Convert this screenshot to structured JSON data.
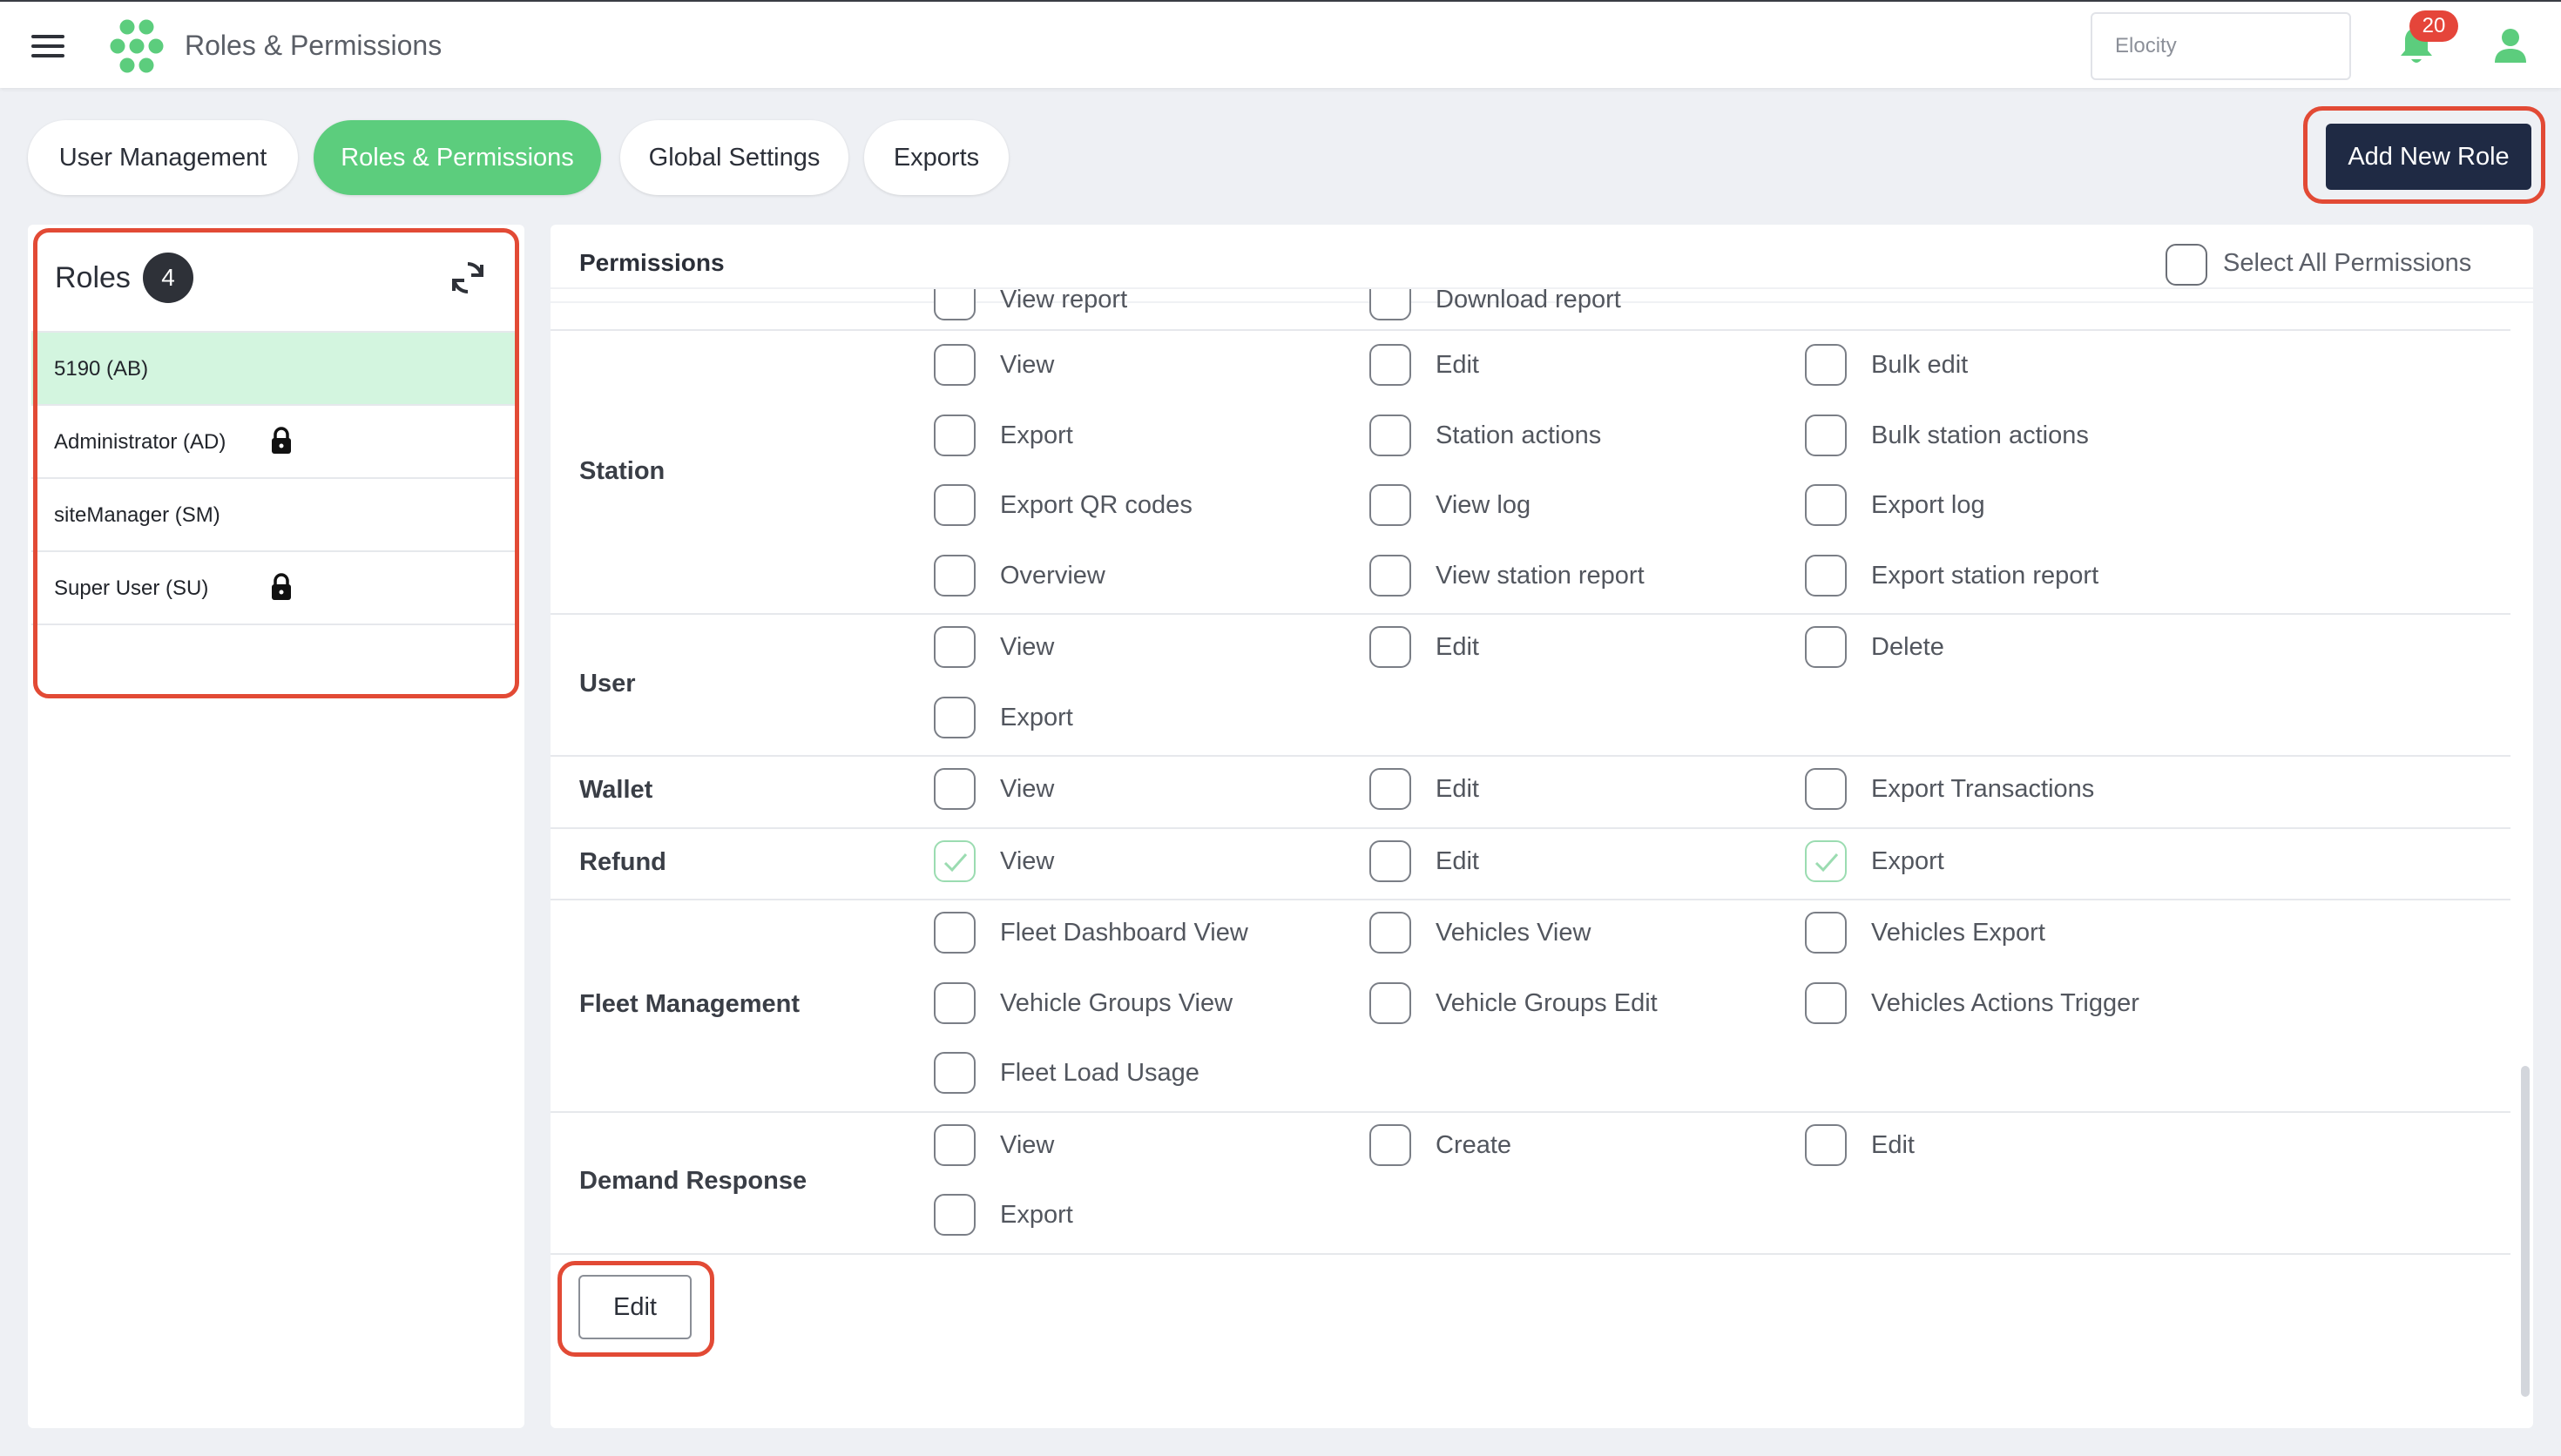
{
  "header": {
    "title": "Roles & Permissions",
    "search_placeholder": "Elocity",
    "notification_count": "20"
  },
  "tabs": [
    {
      "label": "User Management",
      "active": false
    },
    {
      "label": "Roles & Permissions",
      "active": true
    },
    {
      "label": "Global Settings",
      "active": false
    },
    {
      "label": "Exports",
      "active": false
    }
  ],
  "add_role_label": "Add New Role",
  "roles": {
    "title": "Roles",
    "count": "4",
    "items": [
      {
        "label": "5190 (AB)",
        "locked": false,
        "selected": true
      },
      {
        "label": "Administrator (AD)",
        "locked": true,
        "selected": false
      },
      {
        "label": "siteManager (SM)",
        "locked": false,
        "selected": false
      },
      {
        "label": "Super User (SU)",
        "locked": true,
        "selected": false
      }
    ]
  },
  "permissions": {
    "title": "Permissions",
    "select_all_label": "Select All Permissions",
    "partial_top": [
      "View report",
      "Download report"
    ],
    "sections": [
      {
        "name": "Station",
        "items": [
          {
            "label": "View",
            "checked": false
          },
          {
            "label": "Edit",
            "checked": false
          },
          {
            "label": "Bulk edit",
            "checked": false
          },
          {
            "label": "Export",
            "checked": false
          },
          {
            "label": "Station actions",
            "checked": false
          },
          {
            "label": "Bulk station actions",
            "checked": false
          },
          {
            "label": "Export QR codes",
            "checked": false
          },
          {
            "label": "View log",
            "checked": false
          },
          {
            "label": "Export log",
            "checked": false
          },
          {
            "label": "Overview",
            "checked": false
          },
          {
            "label": "View station report",
            "checked": false
          },
          {
            "label": "Export station report",
            "checked": false
          }
        ]
      },
      {
        "name": "User",
        "items": [
          {
            "label": "View",
            "checked": false
          },
          {
            "label": "Edit",
            "checked": false
          },
          {
            "label": "Delete",
            "checked": false
          },
          {
            "label": "Export",
            "checked": false
          }
        ]
      },
      {
        "name": "Wallet",
        "items": [
          {
            "label": "View",
            "checked": false
          },
          {
            "label": "Edit",
            "checked": false
          },
          {
            "label": "Export Transactions",
            "checked": false
          }
        ]
      },
      {
        "name": "Refund",
        "items": [
          {
            "label": "View",
            "checked": true
          },
          {
            "label": "Edit",
            "checked": false
          },
          {
            "label": "Export",
            "checked": true
          }
        ]
      },
      {
        "name": "Fleet Management",
        "items": [
          {
            "label": "Fleet Dashboard View",
            "checked": false
          },
          {
            "label": "Vehicles View",
            "checked": false
          },
          {
            "label": "Vehicles Export",
            "checked": false
          },
          {
            "label": "Vehicle Groups View",
            "checked": false
          },
          {
            "label": "Vehicle Groups Edit",
            "checked": false
          },
          {
            "label": "Vehicles Actions Trigger",
            "checked": false
          },
          {
            "label": "Fleet Load Usage",
            "checked": false
          }
        ]
      },
      {
        "name": "Demand Response",
        "items": [
          {
            "label": "View",
            "checked": false
          },
          {
            "label": "Create",
            "checked": false
          },
          {
            "label": "Edit",
            "checked": false
          },
          {
            "label": "Export",
            "checked": false
          }
        ]
      }
    ],
    "edit_label": "Edit"
  },
  "colors": {
    "accent_green": "#5ccd7d",
    "selected_row": "#d3f5df",
    "primary_dark": "#1f2a44",
    "highlight_red": "#e24a35",
    "badge_red": "#e5453a"
  },
  "icons": [
    "menu-icon",
    "logo-icon",
    "bell-icon",
    "user-icon",
    "refresh-icon",
    "lock-icon",
    "checkmark-icon"
  ]
}
